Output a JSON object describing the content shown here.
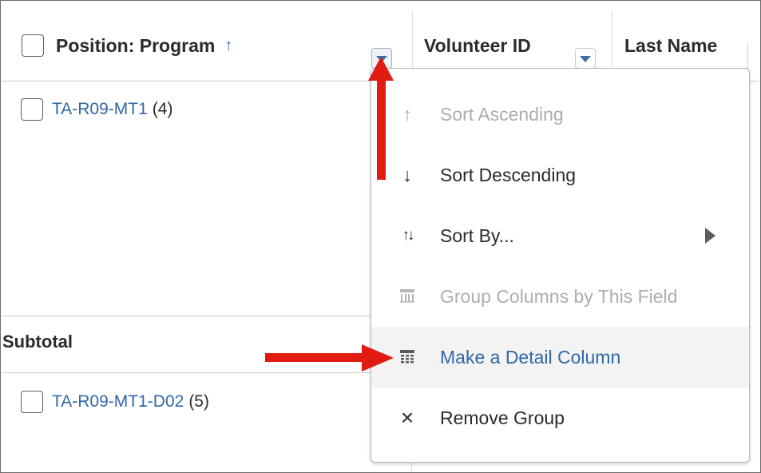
{
  "header": {
    "position_program": "Position: Program",
    "sort_indicator": "↑",
    "volunteer_id": "Volunteer ID",
    "last_name": "Last Name"
  },
  "groups": [
    {
      "link": "TA-R09-MT1",
      "count": "(4)"
    },
    {
      "link": "TA-R09-MT1-D02",
      "count": "(5)"
    }
  ],
  "subtotal_label": "Subtotal",
  "menu": {
    "items": [
      {
        "icon": "↑",
        "label": "Sort Ascending",
        "state": "disabled"
      },
      {
        "icon": "↓",
        "label": "Sort Descending",
        "state": "normal"
      },
      {
        "icon": "↑↓",
        "label": "Sort By...",
        "state": "normal",
        "submenu": true
      },
      {
        "icon": "column-grid-icon",
        "label": "Group Columns by This Field",
        "state": "disabled"
      },
      {
        "icon": "detail-grid-icon",
        "label": "Make a Detail Column",
        "state": "active"
      },
      {
        "icon": "×",
        "label": "Remove Group",
        "state": "normal"
      }
    ]
  },
  "colors": {
    "link": "#2f68a5",
    "annotation_arrow": "#e01b12",
    "disabled_text": "#adadad",
    "active_bg": "#f3f3f3"
  }
}
